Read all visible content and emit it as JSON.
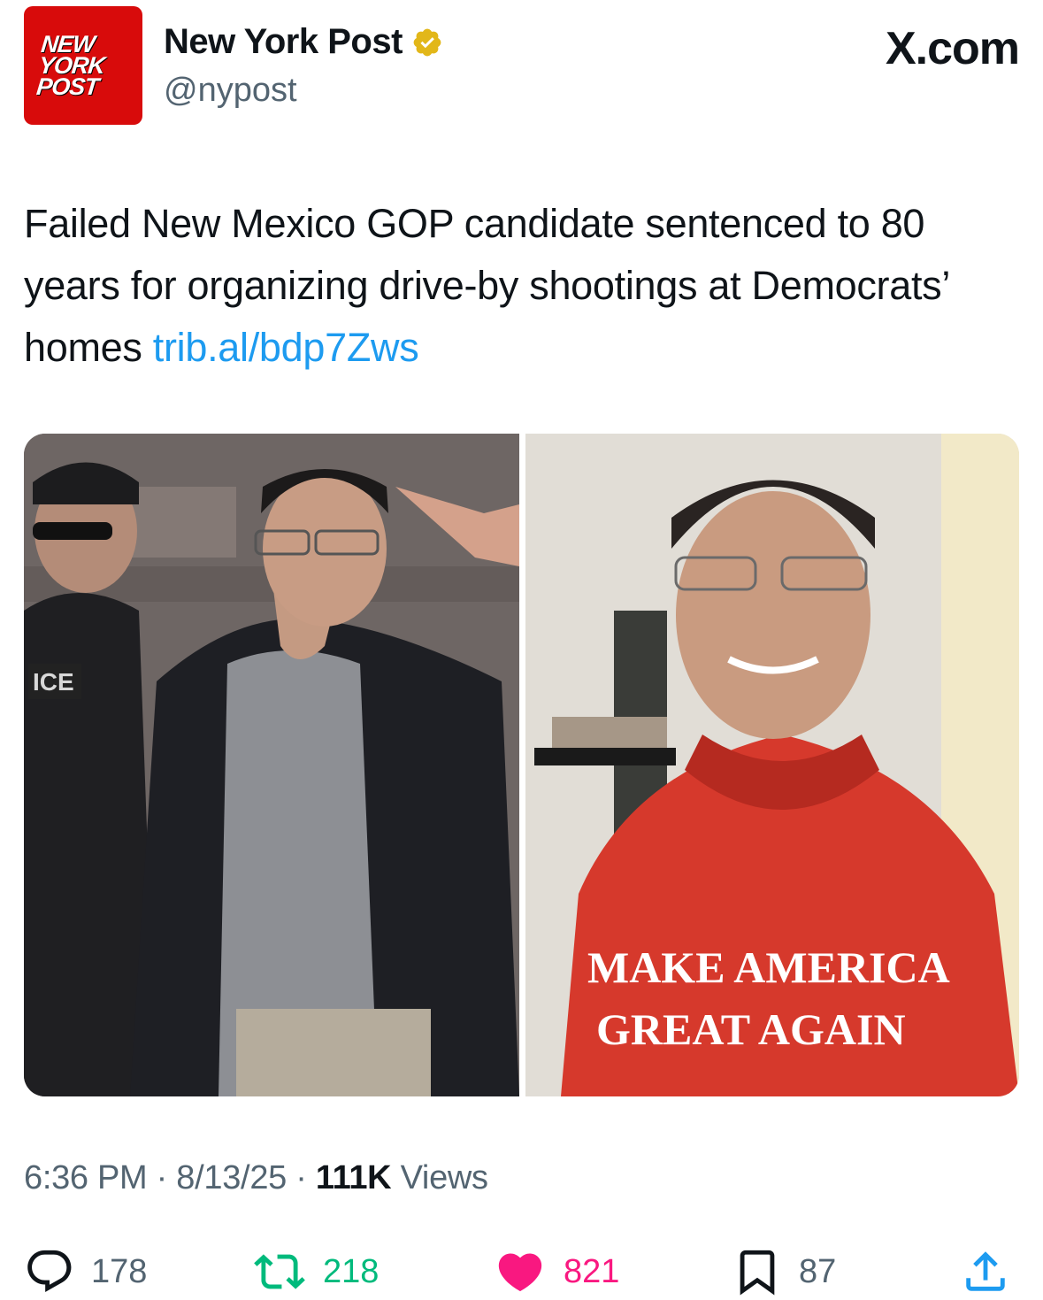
{
  "header": {
    "avatar_lines": [
      "NEW",
      "YORK",
      "POST"
    ],
    "display_name": "New York Post",
    "handle": "@nypost",
    "site": "X.com"
  },
  "tweet": {
    "text": "Failed New Mexico GOP candidate sentenced to 80 years for organizing drive-by shootings at Democrats’ homes",
    "link": "trib.al/bdp7Zws"
  },
  "media": {
    "left_patch": "ICE",
    "right_shirt_line1": "MAKE AMERICA",
    "right_shirt_line2": "GREAT AGAIN"
  },
  "meta": {
    "time": "6:36 PM",
    "sep1": " · ",
    "date": "8/13/25",
    "sep2": " · ",
    "views_count": "111K",
    "views_label": " Views"
  },
  "actions": {
    "replies": "178",
    "retweets": "218",
    "likes": "821",
    "bookmarks": "87"
  },
  "colors": {
    "link": "#1d9bf0",
    "retweet": "#00ba7c",
    "like": "#f91880",
    "brand_red": "#d80b0b",
    "verified_gold": "#e2b719"
  }
}
